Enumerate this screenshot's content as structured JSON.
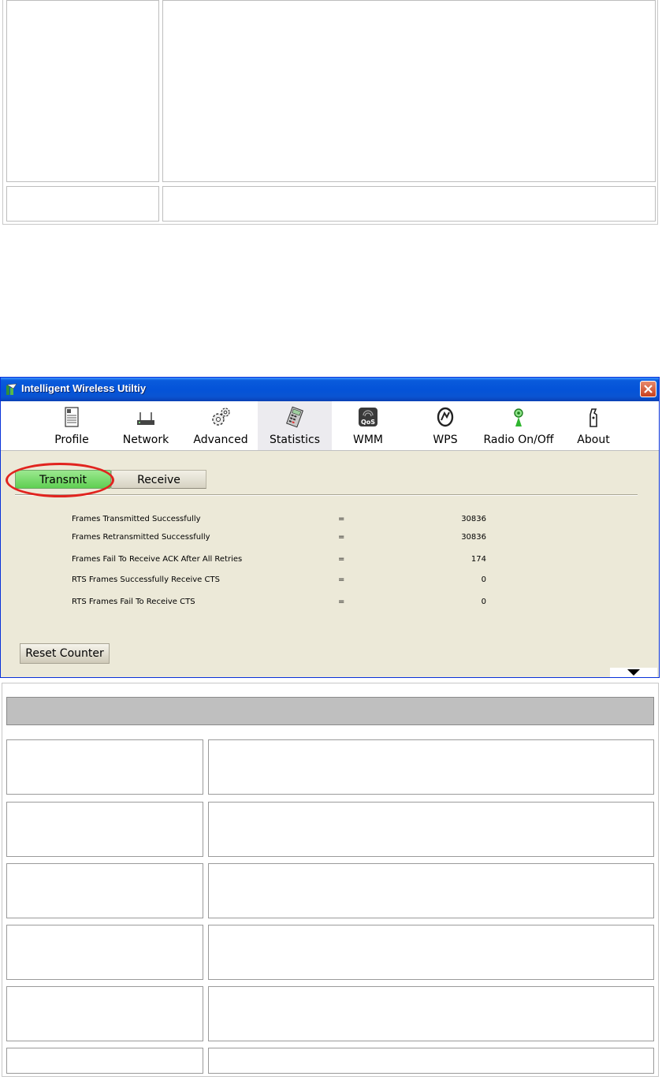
{
  "window": {
    "title": "Intelligent Wireless Utiltiy"
  },
  "toolbar": {
    "items": [
      {
        "label": "Profile",
        "icon": "profile-icon"
      },
      {
        "label": "Network",
        "icon": "network-icon"
      },
      {
        "label": "Advanced",
        "icon": "advanced-icon"
      },
      {
        "label": "Statistics",
        "icon": "statistics-icon",
        "active": true
      },
      {
        "label": "WMM",
        "icon": "wmm-icon"
      },
      {
        "label": "WPS",
        "icon": "wps-icon"
      },
      {
        "label": "Radio On/Off",
        "icon": "radio-icon"
      },
      {
        "label": "About",
        "icon": "about-icon"
      }
    ]
  },
  "tabs": {
    "transmit": "Transmit",
    "receive": "Receive",
    "selected": "Transmit"
  },
  "stats": [
    {
      "name": "Frames Transmitted Successfully",
      "eq": "=",
      "value": "30836"
    },
    {
      "name": "Frames Retransmitted Successfully",
      "eq": "=",
      "value": "30836"
    },
    {
      "name": "Frames Fail To Receive ACK After All Retries",
      "eq": "=",
      "value": "174"
    },
    {
      "name": "RTS Frames Successfully Receive CTS",
      "eq": "=",
      "value": "0"
    },
    {
      "name": "RTS Frames Fail To Receive CTS",
      "eq": "=",
      "value": "0"
    }
  ],
  "buttons": {
    "reset_counter": "Reset Counter"
  },
  "colors": {
    "titlebar": "#0453d8",
    "tab_selected": "#5fcf52",
    "highlight": "#e1241f",
    "panel": "#ece9d8"
  }
}
